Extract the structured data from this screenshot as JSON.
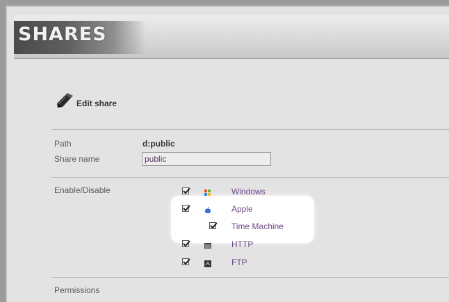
{
  "header": {
    "title": "SHARES"
  },
  "section": {
    "heading": "Edit share",
    "icon": "pencil-icon"
  },
  "form": {
    "path_label": "Path",
    "path_value": "d:public",
    "share_name_label": "Share name",
    "share_name_value": "public",
    "enable_label": "Enable/Disable",
    "permissions_label": "Permissions"
  },
  "services": [
    {
      "label": "Windows",
      "checked": true,
      "icon": "windows-icon"
    },
    {
      "label": "Apple",
      "checked": true,
      "icon": "apple-icon"
    },
    {
      "label": "Time Machine",
      "checked": true,
      "icon": ""
    },
    {
      "label": "HTTP",
      "checked": true,
      "icon": "http-icon"
    },
    {
      "label": "FTP",
      "checked": true,
      "icon": "ftp-icon"
    }
  ],
  "colors": {
    "accent_text": "#6e4a8a",
    "highlight": "#ffffff"
  }
}
